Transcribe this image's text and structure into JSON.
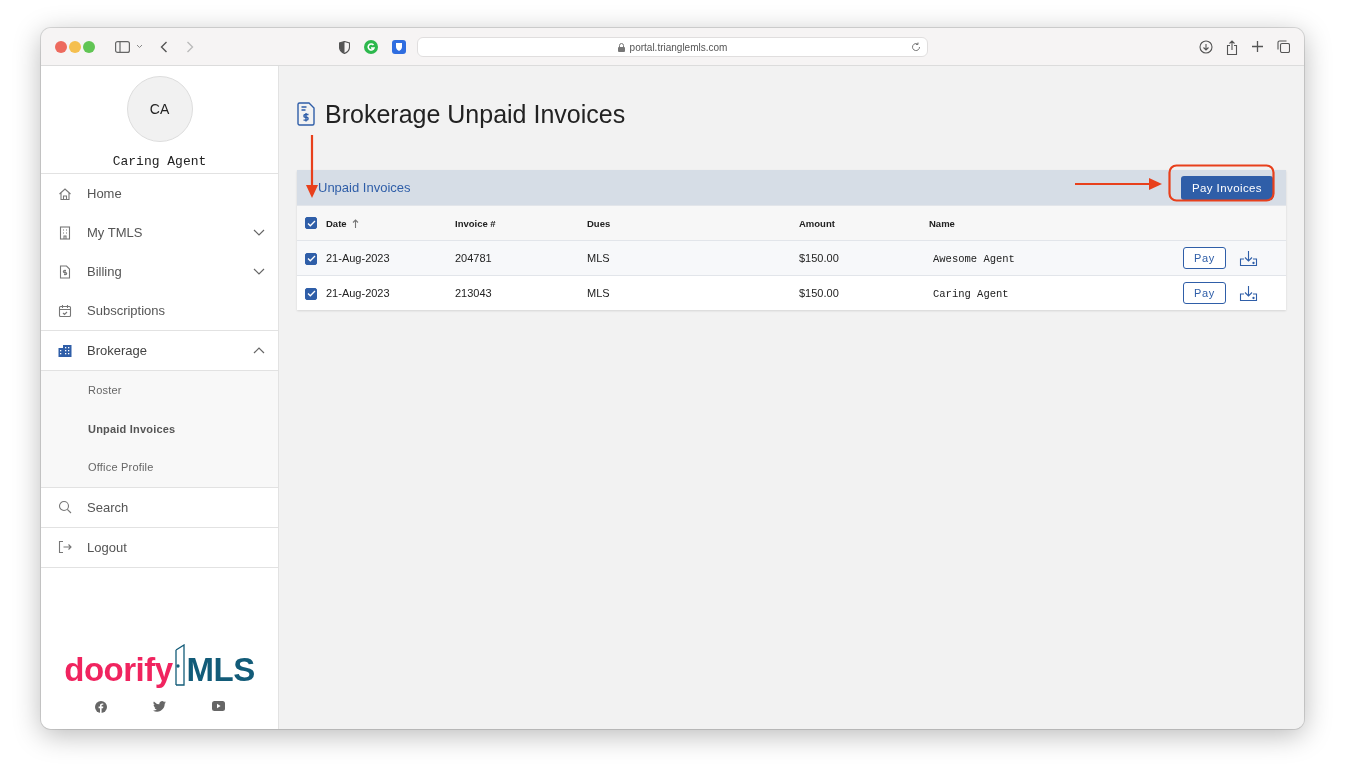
{
  "browser": {
    "url": "portal.trianglemls.com"
  },
  "sidebar": {
    "avatar": {
      "initials": "CA"
    },
    "user_name": "Caring Agent",
    "sections": [
      [
        {
          "kind": "link",
          "label": "Home",
          "selected": false
        },
        {
          "kind": "group",
          "label": "My TMLS",
          "selected": false,
          "expanded": false
        },
        {
          "kind": "group",
          "label": "Billing",
          "selected": false,
          "expanded": false
        },
        {
          "kind": "link",
          "label": "Subscriptions",
          "selected": false
        }
      ],
      [
        {
          "kind": "group",
          "label": "Brokerage",
          "selected": true,
          "expanded": true,
          "children": [
            {
              "label": "Roster",
              "selected": false
            },
            {
              "label": "Unpaid Invoices",
              "selected": true
            },
            {
              "label": "Office Profile",
              "selected": false
            }
          ]
        }
      ],
      [
        {
          "kind": "link",
          "label": "Search",
          "selected": false
        }
      ],
      [
        {
          "kind": "link",
          "label": "Logout",
          "selected": false
        }
      ]
    ],
    "logo": {
      "brand": "doorify",
      "suffix": "MLS"
    }
  },
  "page": {
    "title": "Brokerage Unpaid Invoices"
  },
  "panel": {
    "title": "Unpaid Invoices",
    "action": "Pay Invoices",
    "select_all": {
      "checked": true
    },
    "columns": [
      {
        "label": "Date",
        "sorted": true
      },
      {
        "label": "Invoice #",
        "sorted": false
      },
      {
        "label": "Dues",
        "sorted": false
      },
      {
        "label": "Amount",
        "sorted": false
      },
      {
        "label": "Name",
        "sorted": false
      }
    ],
    "rows": [
      {
        "checked": true,
        "date": "21-Aug-2023",
        "invoice": "204781",
        "dues": "MLS",
        "amount": "$150.00",
        "name": "Awesome Agent",
        "pay": "Pay"
      },
      {
        "checked": true,
        "date": "21-Aug-2023",
        "invoice": "213043",
        "dues": "MLS",
        "amount": "$150.00",
        "name": "Caring Agent",
        "pay": "Pay"
      }
    ]
  }
}
